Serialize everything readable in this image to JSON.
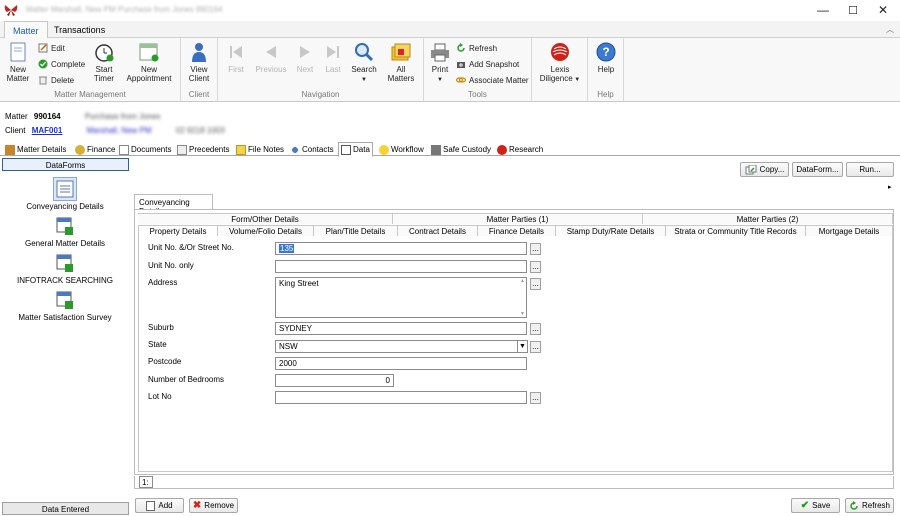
{
  "window": {
    "title": "Matter Marshall, New PM Purchase from Jones 990164",
    "minimize_glyph": "—",
    "maximize_glyph": "☐",
    "close_glyph": "✕"
  },
  "ribbon_tabs": [
    "Matter",
    "Transactions"
  ],
  "ribbon": {
    "matter_management": {
      "label": "Matter Management",
      "new_matter": "New\nMatter",
      "edit": "Edit",
      "complete": "Complete",
      "delete": "Delete",
      "start_timer": "Start\nTimer",
      "new_appointment": "New\nAppointment"
    },
    "client": {
      "label": "Client",
      "view_client": "View\nClient"
    },
    "navigation": {
      "label": "Navigation",
      "first": "First",
      "previous": "Previous",
      "next": "Next",
      "last": "Last",
      "search": "Search",
      "all_matters": "All\nMatters"
    },
    "tools": {
      "label": "Tools",
      "print": "Print",
      "refresh": "Refresh",
      "add_snapshot": "Add Snapshot",
      "associate_matter": "Associate Matter"
    },
    "lexis": {
      "lexis_diligence": "Lexis\nDiligence"
    },
    "help": {
      "label": "Help",
      "help": "Help"
    }
  },
  "matter_info": {
    "matter_label": "Matter",
    "matter_number": "990164",
    "matter_desc": "Purchase from Jones",
    "client_label": "Client",
    "client_code": "MAF001",
    "client_name": "Marshall, New PM",
    "client_phone": "02 9218 1003"
  },
  "matter_tabs": [
    "Matter Details",
    "Finance",
    "Documents",
    "Precedents",
    "File Notes",
    "Contacts",
    "Data",
    "Workflow",
    "Safe Custody",
    "Research"
  ],
  "dataforms": {
    "header": "DataForms",
    "items": [
      "Conveyancing Details",
      "General Matter Details",
      "INFOTRACK SEARCHING",
      "Matter Satisfaction Survey"
    ],
    "footer": "Data Entered"
  },
  "actions": {
    "copy": "Copy...",
    "dataform": "DataForm...",
    "run": "Run..."
  },
  "main_tab": "Conveyancing Details",
  "form_tabs_top": [
    "Form/Other Details",
    "Matter Parties (1)",
    "Matter Parties (2)"
  ],
  "form_tabs_bottom": [
    "Property Details",
    "Volume/Folio Details",
    "Plan/Title Details",
    "Contract Details",
    "Finance Details",
    "Stamp Duty/Rate Details",
    "Strata or Community Title Records",
    "Mortgage Details"
  ],
  "fields": {
    "unit_street_no": {
      "label": "Unit No. &/Or Street No.",
      "value": "135"
    },
    "unit_no_only": {
      "label": "Unit No. only",
      "value": ""
    },
    "address": {
      "label": "Address",
      "value": "King Street"
    },
    "suburb": {
      "label": "Suburb",
      "value": "SYDNEY"
    },
    "state": {
      "label": "State",
      "value": "NSW"
    },
    "postcode": {
      "label": "Postcode",
      "value": "2000"
    },
    "bedrooms": {
      "label": "Number of Bedrooms",
      "value": "0"
    },
    "lot_no": {
      "label": "Lot No",
      "value": ""
    }
  },
  "pager": {
    "page": "1:"
  },
  "bottom_buttons": {
    "add": "Add",
    "remove": "Remove",
    "save": "Save",
    "refresh": "Refresh"
  },
  "colors": {
    "accent": "#1a5ea8",
    "link": "#1a35c4",
    "selection": "#3a78d0"
  }
}
